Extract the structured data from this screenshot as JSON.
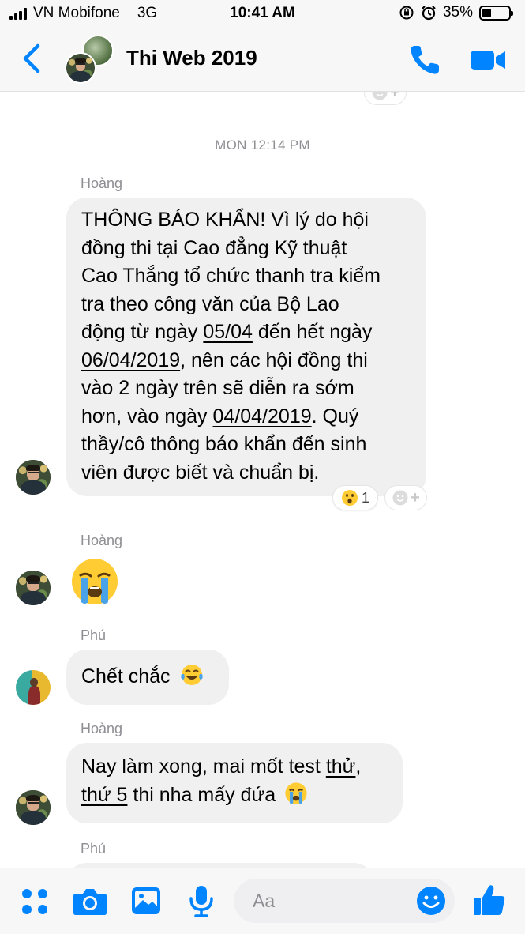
{
  "status_bar": {
    "carrier": "VN Mobifone",
    "network": "3G",
    "time": "10:41 AM",
    "battery_percent": "35%",
    "battery_level": 0.35
  },
  "header": {
    "title": "Thi Web 2019",
    "accent_color": "#0084ff",
    "icons": [
      "chevron-left-icon",
      "phone-icon",
      "video-camera-icon"
    ]
  },
  "messages": {
    "timestamp": "MON 12:14 PM",
    "items": [
      {
        "sender": "Hoàng",
        "lines": [
          [
            "THÔNG BÁO KHẨN! Vì lý do hội"
          ],
          [
            "đồng thi tại Cao đẳng Kỹ thuật"
          ],
          [
            "Cao Thắng tổ chức thanh tra kiểm"
          ],
          [
            "tra theo công văn của Bộ Lao"
          ],
          [
            "động từ ngày ",
            "05/04",
            " đến hết ngày"
          ],
          [
            "06/04/2019",
            ", nên các hội đồng thi"
          ],
          [
            "vào 2 ngày trên sẽ diễn ra sớm"
          ],
          [
            "hơn, vào ngày ",
            "04/04/2019",
            ". Quý"
          ],
          [
            "thầy/cô thông báo khẩn đến sinh"
          ],
          [
            "viên được biết và chuẩn bị."
          ]
        ],
        "reaction_count": "1",
        "reaction_icon": "wow-face-icon"
      },
      {
        "sender": "Hoàng",
        "emoji": "loudly-crying-face-icon"
      },
      {
        "sender": "Phú",
        "text": "Chết chắc",
        "emoji": "tears-of-joy-icon"
      },
      {
        "sender": "Hoàng",
        "line1_a": "Nay làm xong, mai mốt test ",
        "line1_b": "thử",
        "line1_c": ",",
        "line2_a": "thứ 5",
        "line2_b": " thi nha mấy đứa",
        "emoji": "loudly-crying-face-icon"
      },
      {
        "sender": "Phú"
      }
    ]
  },
  "composer": {
    "placeholder": "Aa",
    "icons": [
      "menu-dots-icon",
      "camera-icon",
      "image-icon",
      "microphone-icon",
      "smiley-icon",
      "thumbs-up-icon"
    ]
  }
}
